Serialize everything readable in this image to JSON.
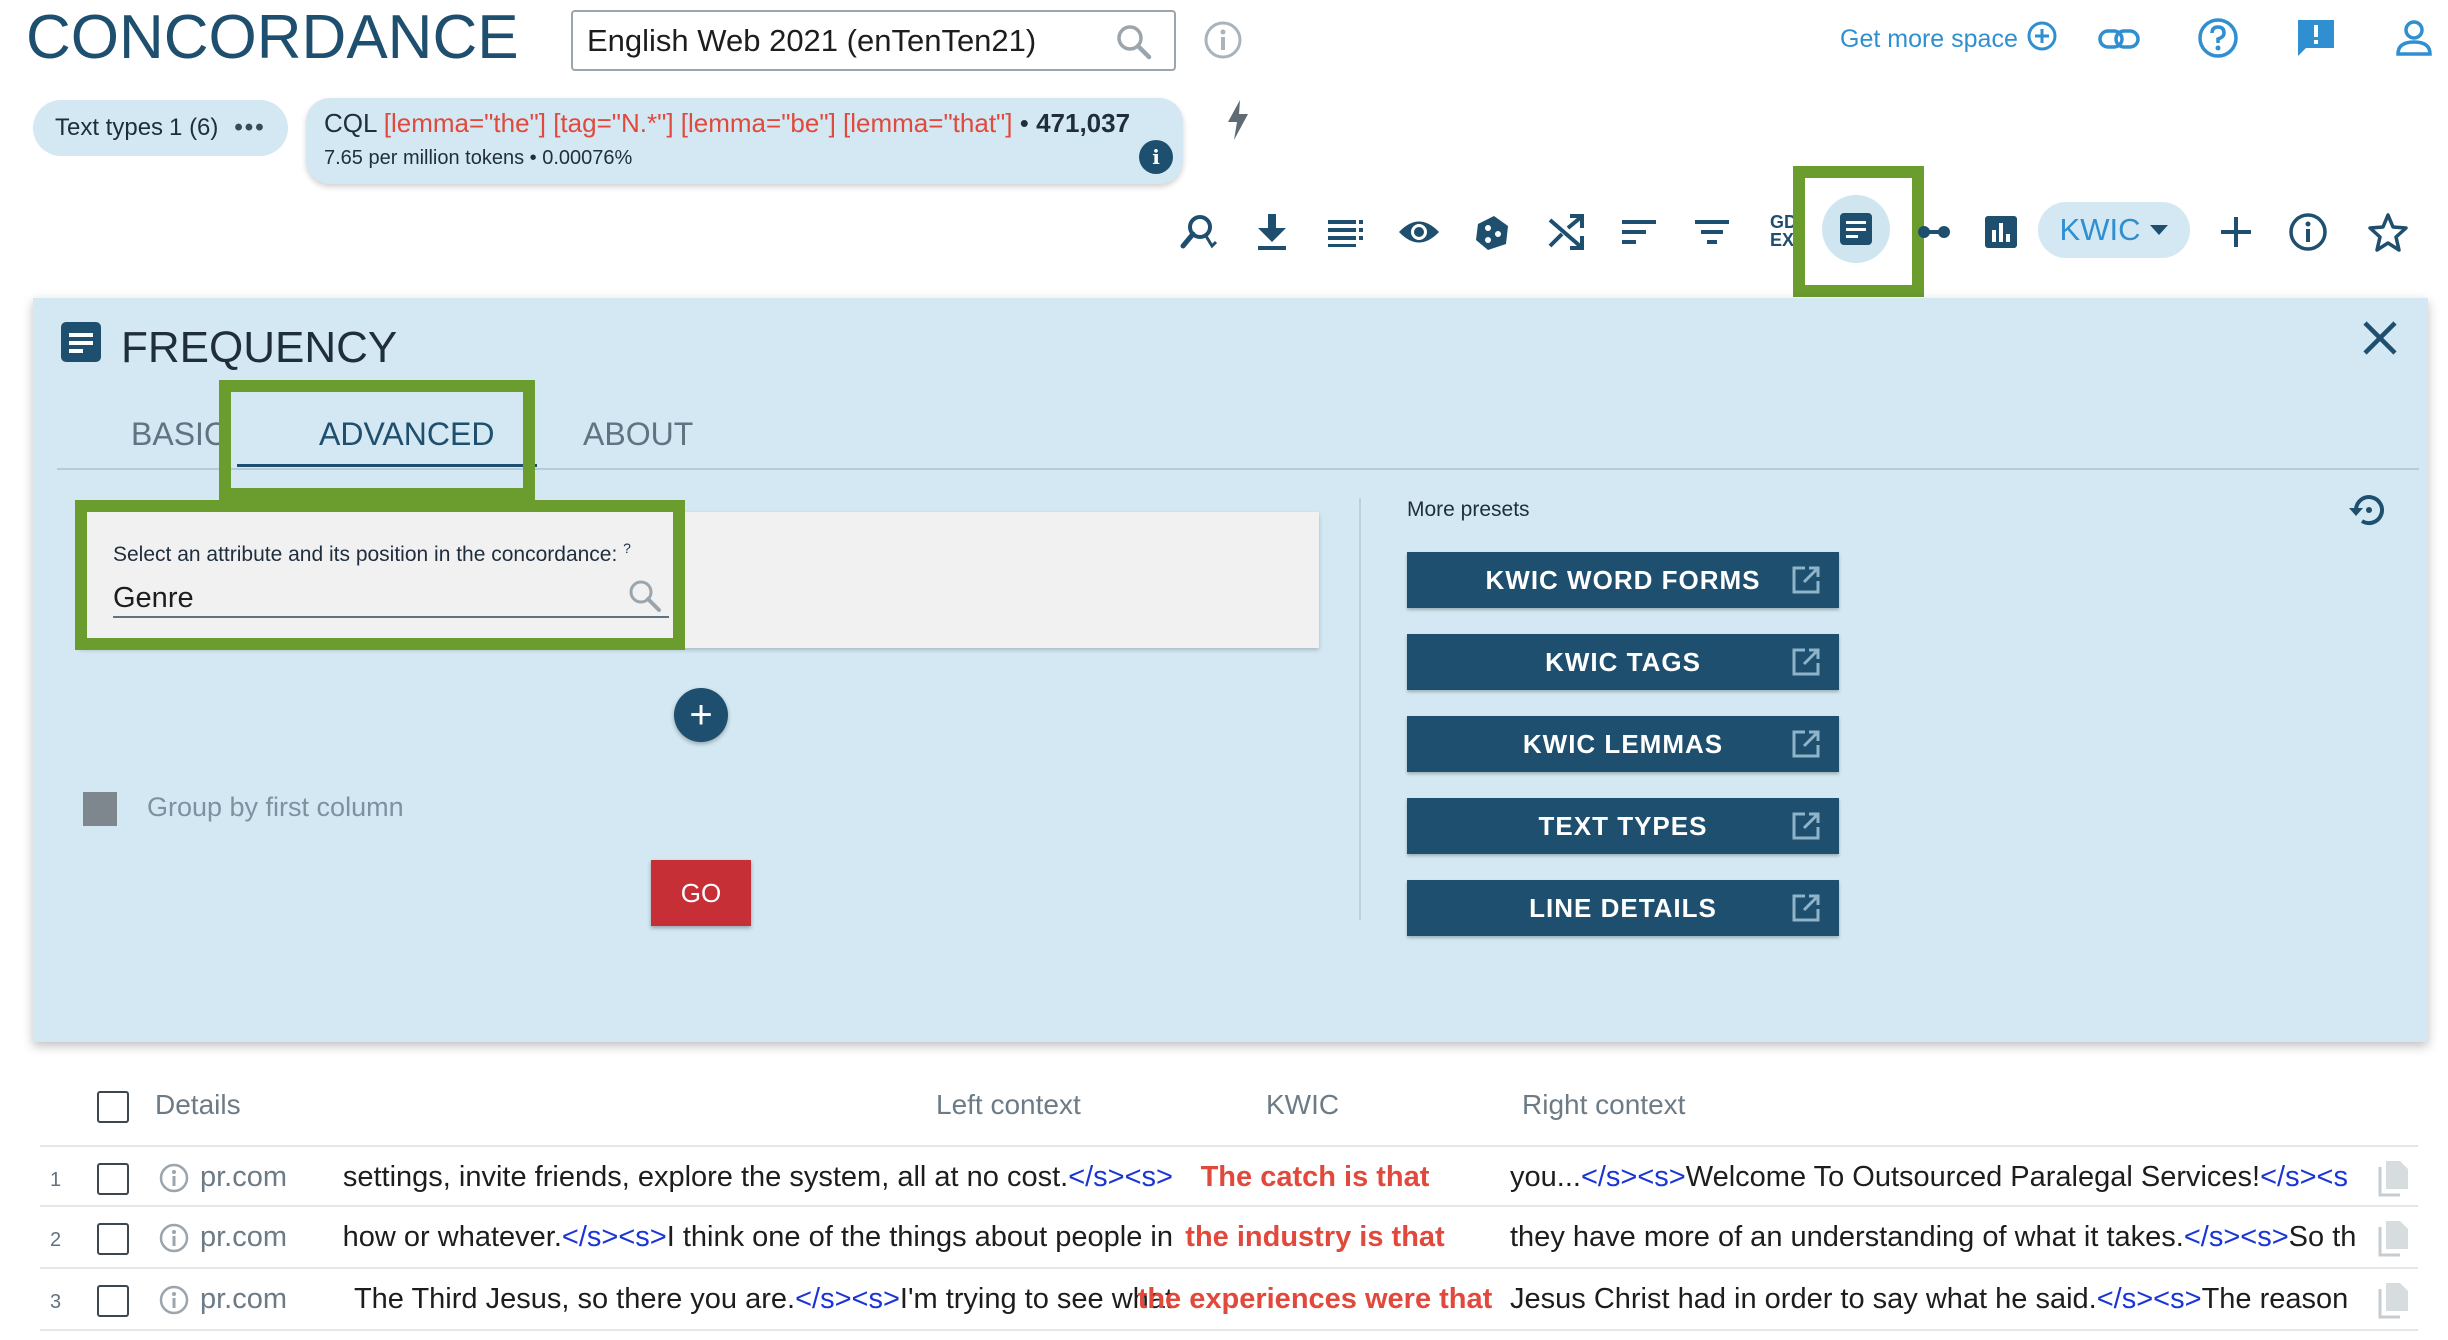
{
  "header": {
    "app_title": "CONCORDANCE",
    "corpus": "English Web 2021 (enTenTen21)",
    "get_more_space": "Get more space"
  },
  "query": {
    "text_types_label": "Text types",
    "text_types_count": "1 (6)",
    "cql_prefix": "CQL",
    "cql_query": "[lemma=\"the\"] [tag=\"N.*\"] [lemma=\"be\"] [lemma=\"that\"]",
    "cql_bullet": "•",
    "hits": "471,037",
    "per_million": "7.65 per million tokens • 0.00076%"
  },
  "toolbar": {
    "gdex_top": "GD",
    "gdex_bottom": "EX",
    "view_mode": "KWIC",
    "icons": [
      "search-refine-icon",
      "download-icon",
      "view-options-icon",
      "eye-icon",
      "sample-icon",
      "shuffle-icon",
      "sort-icon",
      "filter-icon",
      "gdex-icon",
      "frequency-icon",
      "collocations-icon",
      "chart-icon",
      "kwic-dropdown",
      "add-icon",
      "info-icon",
      "star-icon"
    ]
  },
  "panel": {
    "title": "FREQUENCY",
    "tabs": [
      {
        "label": "BASIC",
        "active": false
      },
      {
        "label": "ADVANCED",
        "active": true
      },
      {
        "label": "ABOUT",
        "active": false
      }
    ],
    "attr_label": "Select an attribute and its position in the concordance:",
    "attr_help": "?",
    "attr_value": "Genre",
    "add_symbol": "+",
    "group_label": "Group by first column",
    "group_checked": false,
    "go_label": "GO",
    "presets_title": "More presets",
    "presets": [
      "KWIC WORD FORMS",
      "KWIC TAGS",
      "KWIC LEMMAS",
      "TEXT TYPES",
      "LINE DETAILS"
    ]
  },
  "table": {
    "headers": {
      "details": "Details",
      "left": "Left context",
      "kwic": "KWIC",
      "right": "Right context"
    },
    "rows": [
      {
        "num": "1",
        "source": "pr.com",
        "left": "settings, invite friends, explore the system, all at no cost.",
        "left_tag": "</s><s>",
        "kwic": "The catch is that",
        "right_a": "you...",
        "right_tag1": "</s><s>",
        "right_b": "Welcome To Outsourced Paralegal Services!",
        "right_tag2": "</s><s"
      },
      {
        "num": "2",
        "source": "pr.com",
        "left_a": "how or whatever.",
        "left_tag": "</s><s>",
        "left_b": "I think one of the things about people in",
        "kwic": "the industry is that",
        "right_a": "they have more of an understanding of what it takes.",
        "right_tag1": "</s><s>",
        "right_b": "So th"
      },
      {
        "num": "3",
        "source": "pr.com",
        "left_a": "The Third Jesus, so there you are.",
        "left_tag": "</s><s>",
        "left_b": "I'm trying to see what",
        "kwic": "the experiences were that",
        "right_a": "Jesus Christ had in order to say what he said.",
        "right_tag1": "</s><s>",
        "right_b": "The reason"
      }
    ]
  },
  "colors": {
    "brand": "#1e4f6e",
    "panel_bg": "#d3e8f3",
    "accent_link": "#2f8fd0",
    "kwic_red": "#e0493b",
    "go_red": "#c62f35",
    "tag_blue": "#1a35d6",
    "highlight_green": "#6a9c2e"
  }
}
